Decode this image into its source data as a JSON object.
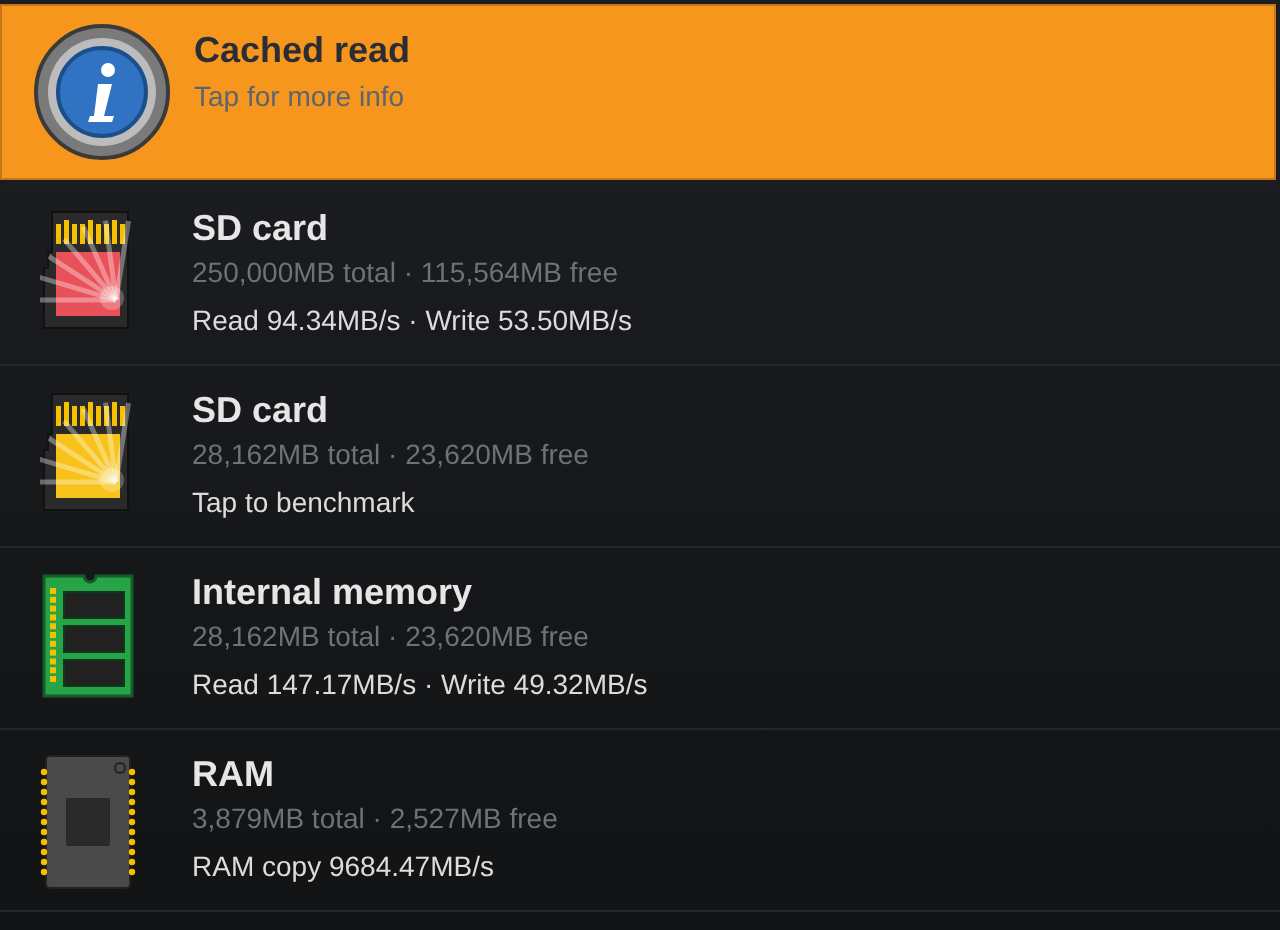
{
  "header": {
    "title": "Cached read",
    "subtitle": "Tap for more info"
  },
  "items": [
    {
      "kind": "sd_card",
      "color": "#e8505a",
      "title": "SD card",
      "capacity": "250,000MB total · 115,564MB free",
      "result": "Read 94.34MB/s · Write 53.50MB/s"
    },
    {
      "kind": "sd_card",
      "color": "#f7c21a",
      "title": "SD card",
      "capacity": "28,162MB total · 23,620MB free",
      "result": "Tap to benchmark"
    },
    {
      "kind": "memory",
      "title": "Internal memory",
      "capacity": "28,162MB total · 23,620MB free",
      "result": "Read 147.17MB/s · Write 49.32MB/s"
    },
    {
      "kind": "ram",
      "title": "RAM",
      "capacity": "3,879MB total · 2,527MB free",
      "result": "RAM copy 9684.47MB/s"
    }
  ]
}
